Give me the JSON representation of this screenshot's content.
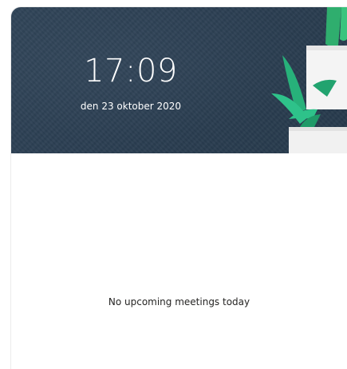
{
  "header": {
    "time": "17:09",
    "date": "den 23 oktober 2020"
  },
  "agenda": {
    "empty_message": "No upcoming meetings today"
  },
  "colors": {
    "header_bg": "#2b3e52",
    "plant_green": "#2ec28a",
    "pot": "#f2f2f2",
    "text": "#252423"
  },
  "icons": {
    "plant": "plant-illustration"
  }
}
